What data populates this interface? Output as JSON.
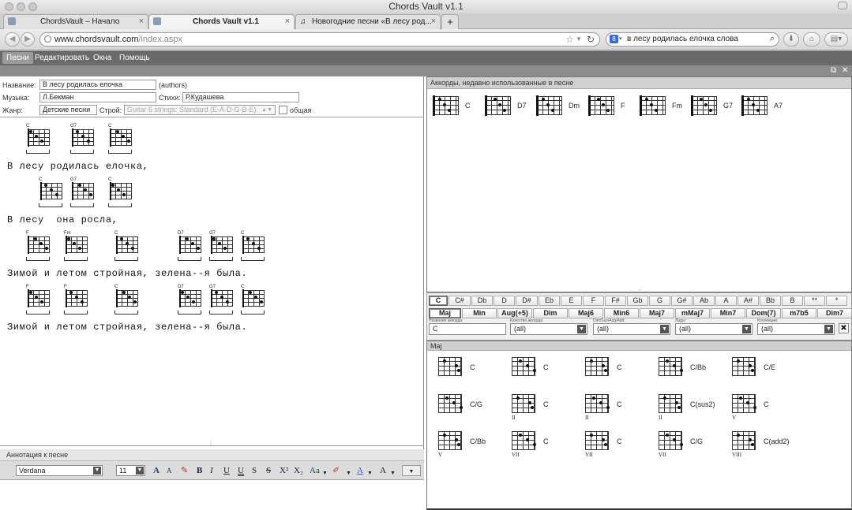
{
  "window": {
    "title": "Chords Vault v1.1"
  },
  "browser_tabs": [
    {
      "label": "ChordsVault – Начало"
    },
    {
      "label": "Chords Vault v1.1"
    },
    {
      "label": "Новогодние песни «В лесу род..."
    }
  ],
  "address": {
    "url_host": "www.chordsvault.com",
    "url_path": "/index.aspx",
    "search_text": "в лесу родилась елочка слова"
  },
  "menu": [
    "Песни",
    "Редактировать",
    "Окна",
    "Помощь"
  ],
  "song": {
    "title_label": "Название:",
    "title_value": "В лесу родилась елочка",
    "authors_link": "(authors)",
    "music_label": "Музыка:",
    "music_value": "Л.Бекман",
    "lyrics_label": "Стихи:",
    "lyrics_value": "Р.Кудашева",
    "genre_label": "Жанр:",
    "genre_value": "Детские песни",
    "tuning_label": "Строй:",
    "tuning_value": "Guitar 6 strings: Standard (E-A-D-G-B-E)",
    "common_label": "общая",
    "lines": [
      {
        "text": "В лесу родилась елочка,",
        "chords": [
          "C",
          "G7",
          "C"
        ]
      },
      {
        "text": "В лесу  она росла,",
        "chords": [
          "C",
          "G7",
          "C"
        ]
      },
      {
        "text": "Зимой и летом стройная, зелена--я была.",
        "chords": [
          "F",
          "Fm",
          "C",
          "D7",
          "G7",
          "C"
        ]
      },
      {
        "text": "Зимой и летом стройная, зелена--я была.",
        "chords": [
          "F",
          "F",
          "C",
          "D7",
          "G7",
          "C"
        ]
      }
    ]
  },
  "annotation": {
    "header": "Аннотация к песне",
    "font_value": "Verdana",
    "size_value": "11",
    "tools": [
      "A",
      "A",
      "B",
      "I",
      "U",
      "U",
      "S",
      "S",
      "X²",
      "X₂",
      "Aa",
      "A",
      "A"
    ]
  },
  "recent": {
    "header": "Аккорды, недавно использованные в песне",
    "chords": [
      "C",
      "D7",
      "Dm",
      "F",
      "Fm",
      "G7",
      "A7"
    ]
  },
  "library": {
    "notes": [
      "C",
      "C#",
      "Db",
      "D",
      "D#",
      "Eb",
      "E",
      "F",
      "F#",
      "Gb",
      "G",
      "G#",
      "Ab",
      "A",
      "A#",
      "Bb",
      "B",
      "**",
      "*"
    ],
    "types": [
      "Maj",
      "Min",
      "Aug(+5)",
      "Dim",
      "Maj6",
      "Min6",
      "Maj7",
      "mMaj7",
      "Min7",
      "Dom(7)",
      "m7b5",
      "Dim7"
    ],
    "filters": [
      {
        "label": "Название аккорда:",
        "value": "C"
      },
      {
        "label": "Качество аккорда:",
        "value": "(all)"
      },
      {
        "label": "Dim/Sus/Aug/Add:",
        "value": "(all)"
      },
      {
        "label": "Лады:",
        "value": "(all)"
      },
      {
        "label": "Коллекции:",
        "value": "(all)"
      }
    ],
    "list_header": "Maj",
    "chords": [
      {
        "name": "C",
        "fret": ""
      },
      {
        "name": "C",
        "fret": ""
      },
      {
        "name": "C",
        "fret": ""
      },
      {
        "name": "C/Bb",
        "fret": ""
      },
      {
        "name": "C/E",
        "fret": ""
      },
      {
        "name": "C/G",
        "fret": ""
      },
      {
        "name": "C",
        "fret": "II"
      },
      {
        "name": "C",
        "fret": "II"
      },
      {
        "name": "C(sus2)",
        "fret": "II"
      },
      {
        "name": "C",
        "fret": "V"
      },
      {
        "name": "C/Bb",
        "fret": "V"
      },
      {
        "name": "C",
        "fret": "VII"
      },
      {
        "name": "C",
        "fret": "VII"
      },
      {
        "name": "C/G",
        "fret": "VII"
      },
      {
        "name": "C(add2)",
        "fret": "VIII"
      }
    ]
  }
}
